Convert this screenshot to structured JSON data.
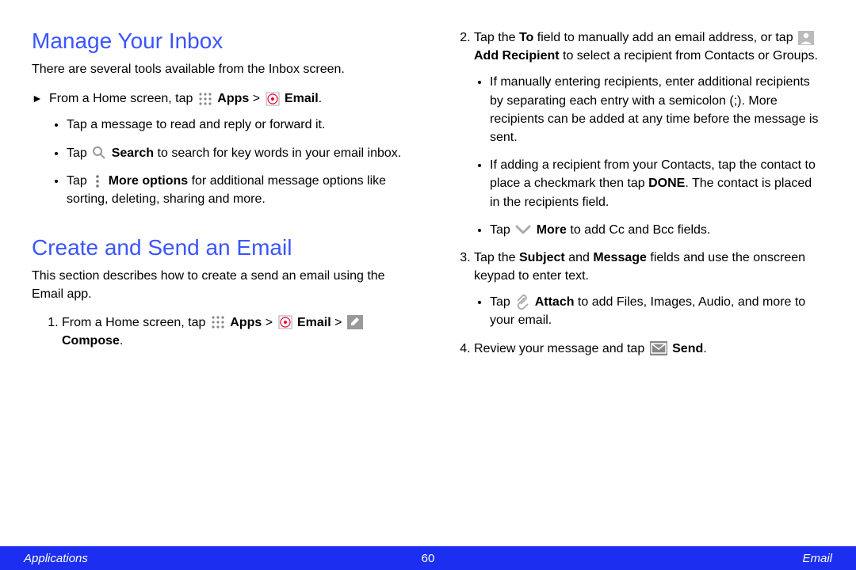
{
  "left": {
    "h1": "Manage Your Inbox",
    "p1": "There are several tools available from the Inbox screen.",
    "home_prefix": "From a Home screen, tap ",
    "apps": "Apps",
    "gt": " > ",
    "email": "Email",
    "period": ".",
    "b1": "Tap a message to read and reply or forward it.",
    "b2a": "Tap ",
    "b2b": "Search",
    "b2c": " to search for key words in your email inbox.",
    "b3a": "Tap ",
    "b3b": "More options",
    "b3c": " for additional message options like sorting, deleting, sharing and more.",
    "h2": "Create and Send an Email",
    "p2": "This section describes how to create a send an email using the Email app.",
    "s1a": "From a Home screen, tap ",
    "s1b": "Compose",
    "s1c": "."
  },
  "right": {
    "s2a": "Tap the ",
    "s2b": "To",
    "s2c": " field to manually add an email address, or tap ",
    "s2d": "Add Recipient",
    "s2e": " to select a recipient from Contacts or Groups.",
    "s2_sub1": "If manually entering recipients, enter additional recipients by separating each entry with a semicolon (;). More recipients can be added at any time before the message is sent.",
    "s2_sub2a": "If adding a recipient from your Contacts, tap the contact to place a checkmark then tap ",
    "s2_sub2b": "DONE",
    "s2_sub2c": ". The contact is placed in the recipients field.",
    "s2_sub3a": "Tap ",
    "s2_sub3b": "More",
    "s2_sub3c": " to add Cc and Bcc fields.",
    "s3a": "Tap the ",
    "s3b": "Subject",
    "s3c": " and ",
    "s3d": "Message",
    "s3e": " fields and use the onscreen keypad to enter text.",
    "s3_sub1a": "Tap ",
    "s3_sub1b": "Attach",
    "s3_sub1c": " to add Files, Images, Audio, and more to your email.",
    "s4a": "Review your message and tap ",
    "s4b": "Send",
    "s4c": "."
  },
  "footer": {
    "left": "Applications",
    "center": "60",
    "right": "Email"
  }
}
